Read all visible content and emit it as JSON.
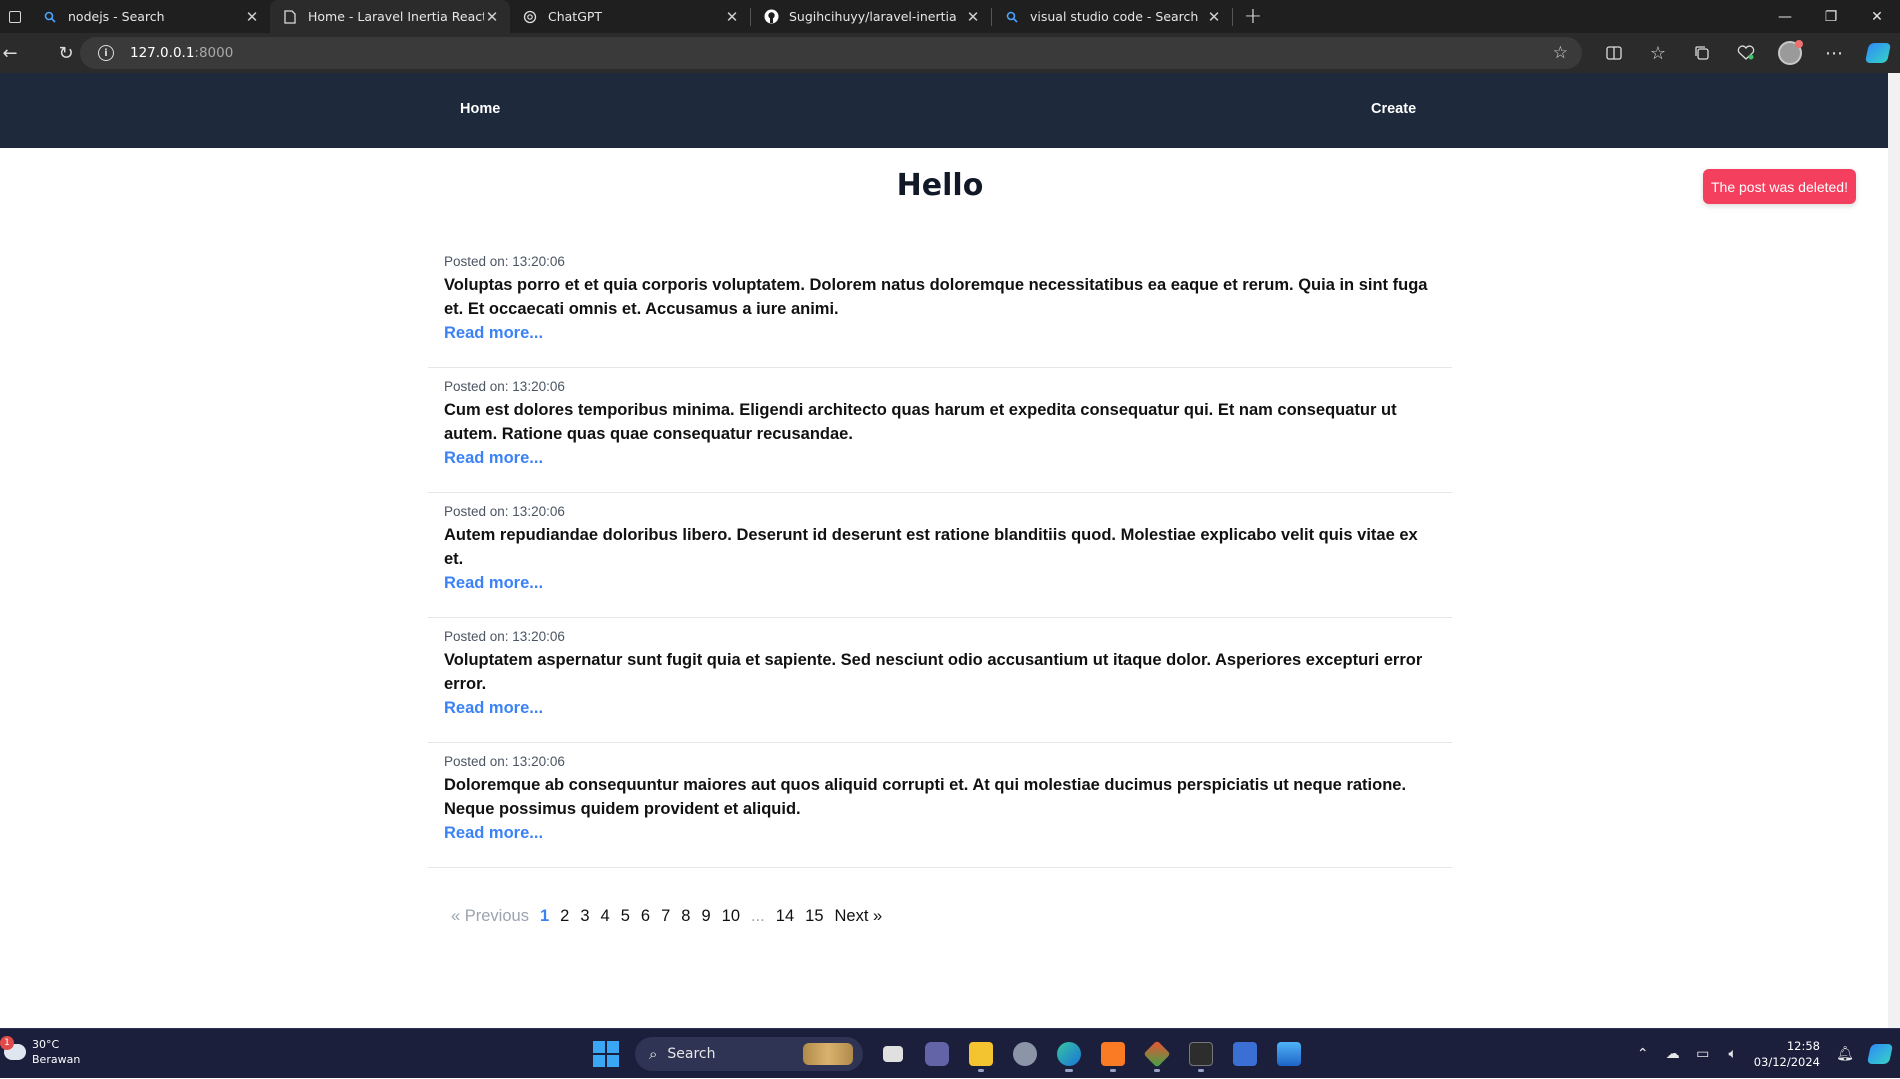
{
  "browser": {
    "tabs": [
      {
        "title": "nodejs - Search",
        "icon": "search-icon",
        "active": false
      },
      {
        "title": "Home - Laravel Inertia React",
        "icon": "page-icon",
        "active": true
      },
      {
        "title": "ChatGPT",
        "icon": "chatgpt-icon",
        "active": false
      },
      {
        "title": "Sugihcihuyy/laravel-inertia",
        "icon": "github-icon",
        "active": false
      },
      {
        "title": "visual studio code - Search",
        "icon": "search-icon",
        "active": false
      }
    ],
    "address": {
      "host": "127.0.0.1",
      "port": ":8000"
    },
    "tab_close_glyph": "✕",
    "new_tab_glyph": "+"
  },
  "nav": {
    "home_label": "Home",
    "create_label": "Create"
  },
  "flash": {
    "message": "The post was deleted!",
    "color": "#f43f5e"
  },
  "page": {
    "title": "Hello"
  },
  "posts": [
    {
      "meta": "Posted on: 13:20:06",
      "body": "Voluptas porro et et quia corporis voluptatem. Dolorem natus doloremque necessitatibus ea eaque et rerum. Quia in sint fuga et. Et occaecati omnis et. Accusamus a iure animi.",
      "more": "Read more..."
    },
    {
      "meta": "Posted on: 13:20:06",
      "body": "Cum est dolores temporibus minima. Eligendi architecto quas harum et expedita consequatur qui. Et nam consequatur ut autem. Ratione quas quae consequatur recusandae.",
      "more": "Read more..."
    },
    {
      "meta": "Posted on: 13:20:06",
      "body": "Autem repudiandae doloribus libero. Deserunt id deserunt est ratione blanditiis quod. Molestiae explicabo velit quis vitae ex et.",
      "more": "Read more..."
    },
    {
      "meta": "Posted on: 13:20:06",
      "body": "Voluptatem aspernatur sunt fugit quia et sapiente. Sed nesciunt odio accusantium ut itaque dolor. Asperiores excepturi error error.",
      "more": "Read more..."
    },
    {
      "meta": "Posted on: 13:20:06",
      "body": "Doloremque ab consequuntur maiores aut quos aliquid corrupti et. At qui molestiae ducimus perspiciatis ut neque ratione. Neque possimus quidem provident et aliquid.",
      "more": "Read more..."
    }
  ],
  "pagination": {
    "previous": "« Previous",
    "pages": [
      "1",
      "2",
      "3",
      "4",
      "5",
      "6",
      "7",
      "8",
      "9",
      "10"
    ],
    "ellipsis": "...",
    "tail_pages": [
      "14",
      "15"
    ],
    "next": "Next »",
    "current": "1"
  },
  "taskbar": {
    "weather_temp": "30°C",
    "weather_desc": "Berawan",
    "weather_badge": "1",
    "search_label": "Search",
    "time": "12:58",
    "date": "03/12/2024"
  },
  "colors": {
    "navbar": "#1e293b",
    "link": "#3b82f6",
    "chrome": "#1f1f1f"
  }
}
